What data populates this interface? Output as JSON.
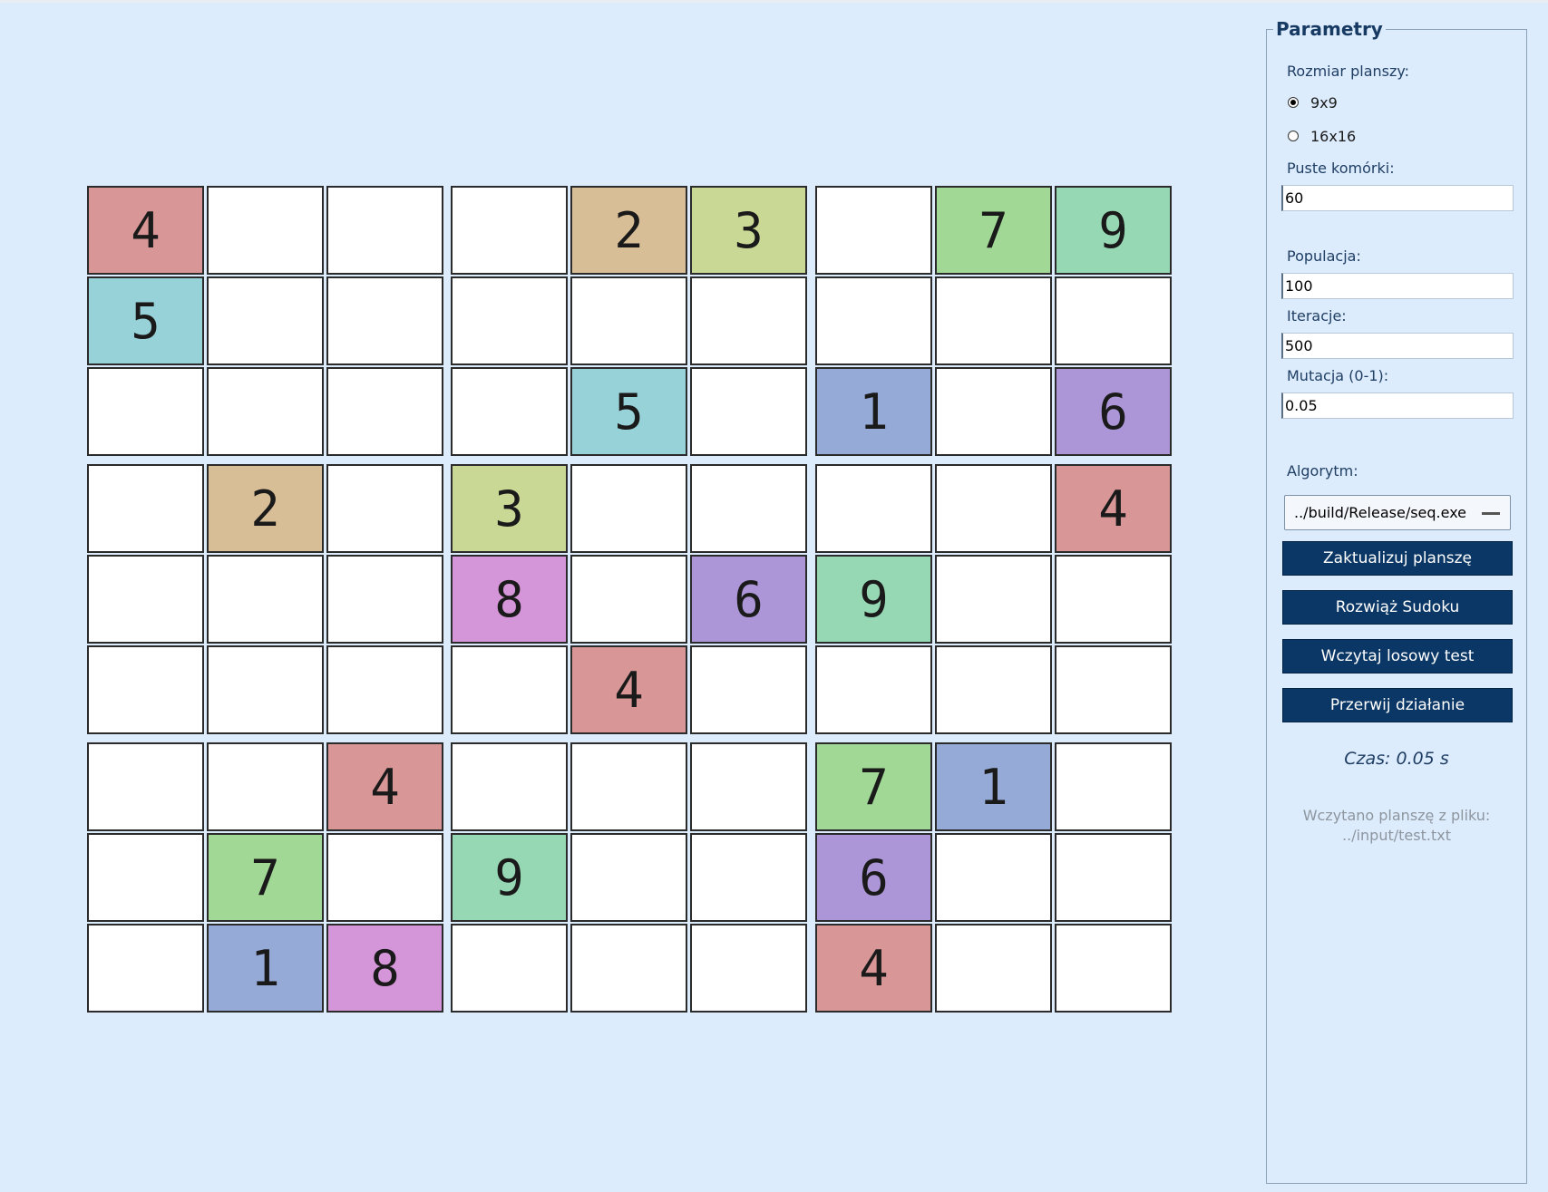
{
  "board": {
    "size": 9,
    "cells": [
      [
        "4",
        "",
        "",
        "",
        "2",
        "3",
        "",
        "7",
        "9"
      ],
      [
        "5",
        "",
        "",
        "",
        "",
        "",
        "",
        "",
        ""
      ],
      [
        "",
        "",
        "",
        "",
        "5",
        "",
        "1",
        "",
        "6"
      ],
      [
        "",
        "2",
        "",
        "3",
        "",
        "",
        "",
        "",
        "4"
      ],
      [
        "",
        "",
        "",
        "8",
        "",
        "6",
        "9",
        "",
        ""
      ],
      [
        "",
        "",
        "",
        "",
        "4",
        "",
        "",
        "",
        ""
      ],
      [
        "",
        "",
        "4",
        "",
        "",
        "",
        "7",
        "1",
        ""
      ],
      [
        "",
        "7",
        "",
        "9",
        "",
        "",
        "6",
        "",
        ""
      ],
      [
        "",
        "1",
        "8",
        "",
        "",
        "",
        "4",
        "",
        ""
      ]
    ],
    "digit_colors": {
      "1": "#96aad8",
      "2": "#d8be96",
      "3": "#cad896",
      "4": "#d89696",
      "5": "#96d2d8",
      "6": "#ac96d8",
      "7": "#a2d896",
      "8": "#d496d8",
      "9": "#96d8b4"
    },
    "empty_color": "#ffffff"
  },
  "panel": {
    "title": "Parametry",
    "board_size_label": "Rozmiar planszy:",
    "size_options": [
      {
        "label": "9x9",
        "selected": true
      },
      {
        "label": "16x16",
        "selected": false
      }
    ],
    "empty_cells_label": "Puste komórki:",
    "empty_cells_value": "60",
    "population_label": "Populacja:",
    "population_value": "100",
    "iterations_label": "Iteracje:",
    "iterations_value": "500",
    "mutation_label": "Mutacja (0-1):",
    "mutation_value": "0.05",
    "algorithm_label": "Algorytm:",
    "algorithm_value": "../build/Release/seq.exe",
    "update_button": "Zaktualizuj planszę",
    "solve_button": "Rozwiąż Sudoku",
    "load_test_button": "Wczytaj losowy test",
    "abort_button": "Przerwij działanie",
    "time_text": "Czas: 0.05 s",
    "status_line1": "Wczytano planszę z pliku:",
    "status_line2": "../input/test.txt"
  }
}
